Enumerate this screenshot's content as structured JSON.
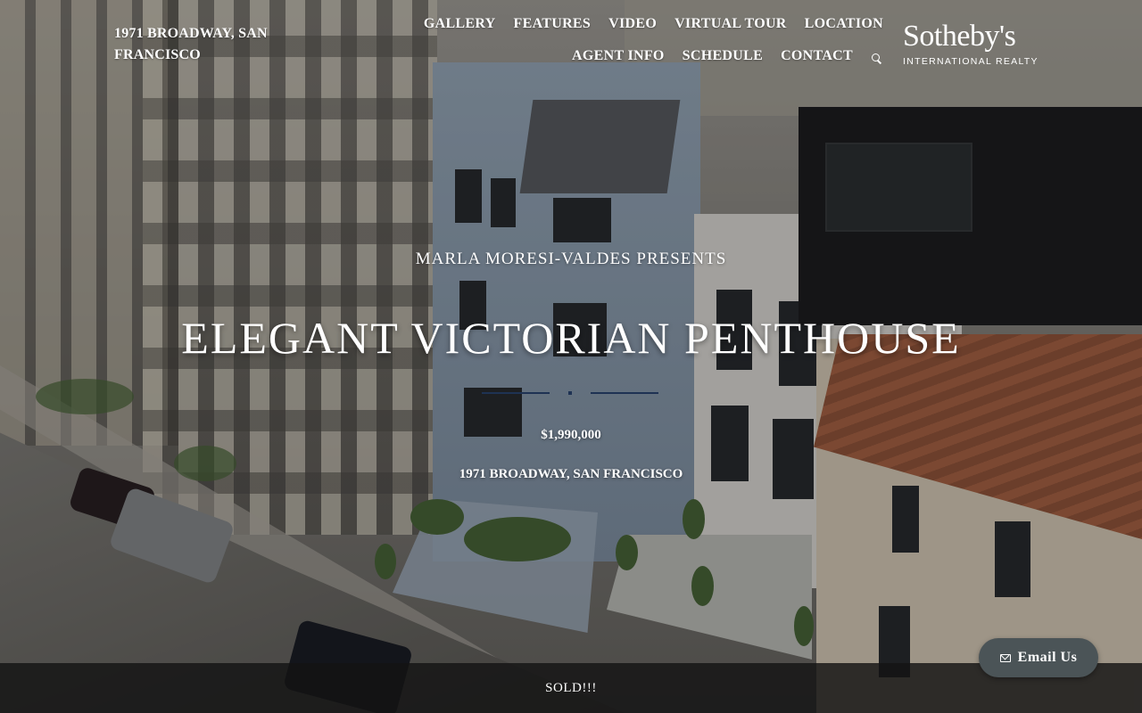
{
  "header": {
    "address": "1971 BROADWAY, SAN FRANCISCO",
    "nav": [
      {
        "label": "GALLERY"
      },
      {
        "label": "FEATURES"
      },
      {
        "label": "VIDEO"
      },
      {
        "label": "VIRTUAL TOUR"
      },
      {
        "label": "LOCATION"
      },
      {
        "label": "AGENT INFO"
      },
      {
        "label": "SCHEDULE"
      },
      {
        "label": "CONTACT"
      }
    ],
    "search_icon": "search-icon",
    "logo": {
      "brand": "Sotheby's",
      "subtitle": "INTERNATIONAL REALTY"
    }
  },
  "hero": {
    "presents": "MARLA MORESI-VALDES PRESENTS",
    "headline": "ELEGANT VICTORIAN PENTHOUSE",
    "price": "$1,990,000",
    "address": "1971 BROADWAY, SAN FRANCISCO",
    "divider_color": "#1e3253"
  },
  "status_bar": {
    "text": "SOLD!!!"
  },
  "email_button": {
    "label": "Email Us",
    "icon": "envelope-icon"
  }
}
